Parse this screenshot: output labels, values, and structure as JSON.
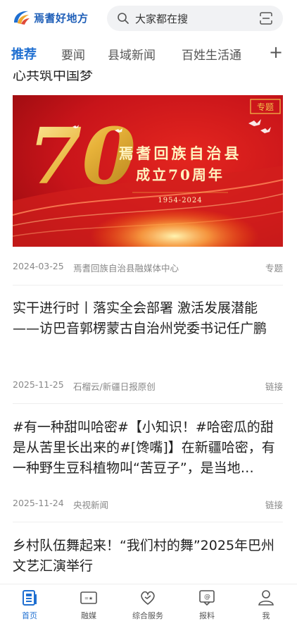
{
  "header": {
    "logo_text": "焉耆好地方",
    "search_placeholder": "大家都在搜"
  },
  "tabs": [
    {
      "label": "推荐",
      "active": true
    },
    {
      "label": "要闻",
      "active": false
    },
    {
      "label": "县域新闻",
      "active": false
    },
    {
      "label": "百姓生活通",
      "active": false
    }
  ],
  "tab_plus": "+",
  "feed": {
    "prev_title_tail": "心共筑中国梦",
    "banner": {
      "badge": "专题",
      "title_line1": "焉耆回族自治县",
      "title_line2": "成立70周年",
      "years": "1954-2024",
      "big_number": "70"
    },
    "items": [
      {
        "date": "2024-03-25",
        "source": "焉耆回族自治县融媒体中心",
        "tag": "专题"
      },
      {
        "title": "实干进行时丨落实全会部署 激活发展潜能——访巴音郭楞蒙古自治州党委书记任广鹏",
        "date": "2025-11-25",
        "source": "石榴云/新疆日报原创",
        "tag": "链接"
      },
      {
        "title": "#有一种甜叫哈密#【小知识！#哈密瓜的甜是从苦里长出来的#[馋嘴]】在新疆哈密，有一种野生豆科植物叫“苦豆子”，是当地…",
        "date": "2025-11-24",
        "source": "央视新闻",
        "tag": "链接"
      },
      {
        "title": "乡村队伍舞起来！“我们村的舞”2025年巴州文艺汇演举行"
      }
    ]
  },
  "bottom_nav": [
    {
      "label": "首页",
      "icon": "home-icon",
      "active": true
    },
    {
      "label": "融媒",
      "icon": "media-icon",
      "active": false
    },
    {
      "label": "综合服务",
      "icon": "services-icon",
      "active": false
    },
    {
      "label": "报料",
      "icon": "report-icon",
      "active": false
    },
    {
      "label": "我",
      "icon": "profile-icon",
      "active": false
    }
  ],
  "colors": {
    "accent": "#1f6fd1",
    "banner_red": "#c8141a",
    "gold": "#f2c04a"
  }
}
